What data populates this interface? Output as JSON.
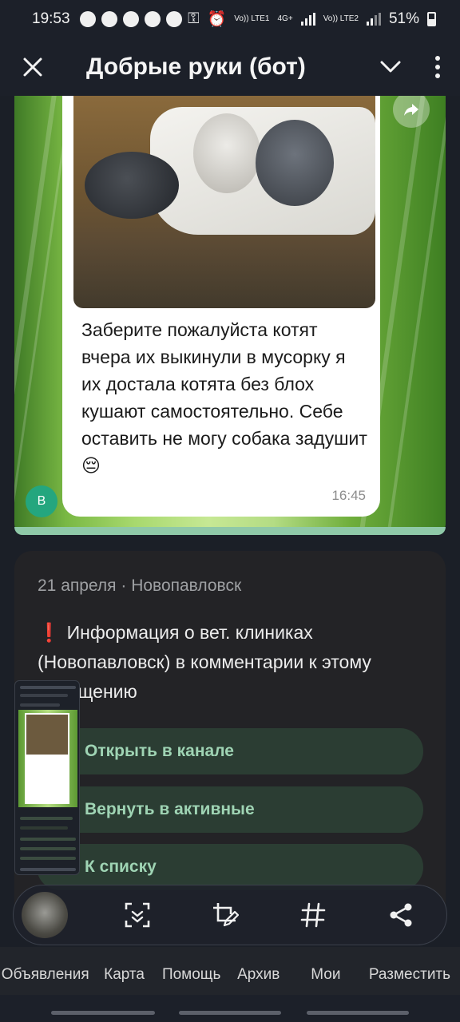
{
  "status_bar": {
    "time": "19:53",
    "battery": "51%",
    "sim1": "Vo)) LTE1",
    "sim2": "Vo)) LTE2",
    "network": "4G+"
  },
  "header": {
    "title": "Добрые руки (бот)"
  },
  "message": {
    "text": "Заберите пожалуйста котят вчера их выкинули в мусорку я их достала котята без блох кушают самостоятельно. Себе оставить не могу собака задушит😔",
    "time": "16:45",
    "avatar_letter": "В"
  },
  "post": {
    "meta": "21 апреля · Новопавловск",
    "exclaim": "❗",
    "text": "Информация о вет. клиниках (Новопавловск) в комментарии к этому сообщению",
    "buttons": [
      "Открыть в канале",
      "Вернуть в активные",
      "К списку"
    ]
  },
  "bottom_nav": {
    "items": [
      "Объявления",
      "Карта",
      "Помощь",
      "Архив",
      "Мои",
      "Разместить"
    ]
  },
  "colors": {
    "background": "#1b1f27",
    "card": "#232326",
    "button_bg": "#2b3d33",
    "button_text": "#9fd4b4",
    "avatar": "#24a67e"
  },
  "icons": {
    "close": "close-icon",
    "chevron": "chevron-down-icon",
    "menu": "kebab-menu-icon",
    "share": "share-arrow-icon",
    "toolbar": [
      "scan-text-icon",
      "edit-crop-icon",
      "hashtag-icon",
      "share-icon"
    ]
  }
}
